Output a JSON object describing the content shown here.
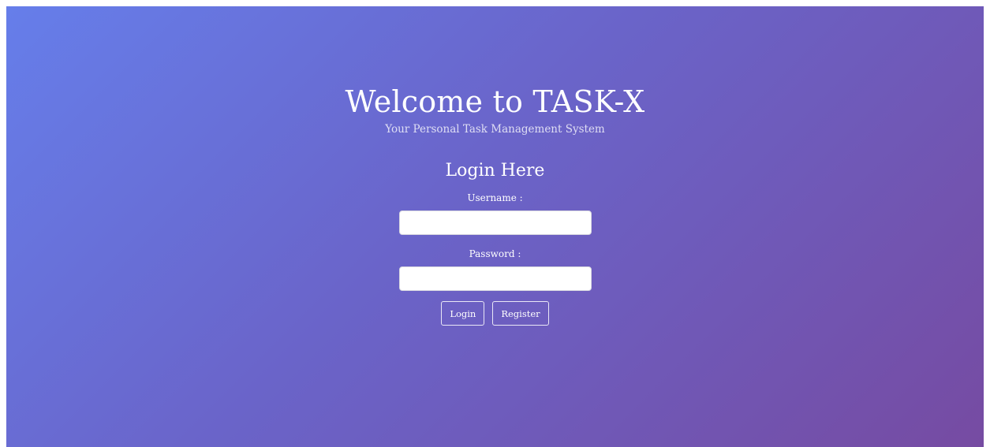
{
  "header": {
    "title": "Welcome to TASK-X",
    "subtitle": "Your Personal Task Management System"
  },
  "login_form": {
    "heading": "Login Here",
    "username_label": "Username :",
    "username_value": "",
    "username_placeholder": "",
    "password_label": "Password :",
    "password_value": "",
    "password_placeholder": "",
    "login_button": "Login",
    "register_button": "Register"
  },
  "colors": {
    "gradient_start": "#667eea",
    "gradient_end": "#764ba2",
    "text": "#ffffff"
  }
}
